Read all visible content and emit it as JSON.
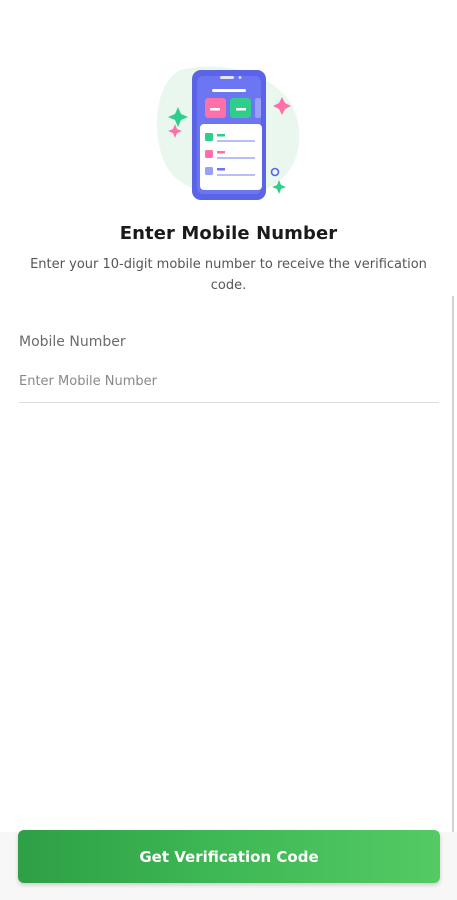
{
  "header": {
    "illustration_icon": "phone-verification-illustration",
    "title": "Enter Mobile Number",
    "subtitle": "Enter your 10-digit mobile number to receive the verification code."
  },
  "form": {
    "mobile_label": "Mobile Number",
    "mobile_placeholder": "Enter Mobile Number",
    "mobile_value": ""
  },
  "footer": {
    "button_label": "Get Verification Code"
  },
  "colors": {
    "accent_green": "#3fb955",
    "phone_body": "#6a6ff0",
    "blob": "#e9f7ef"
  }
}
